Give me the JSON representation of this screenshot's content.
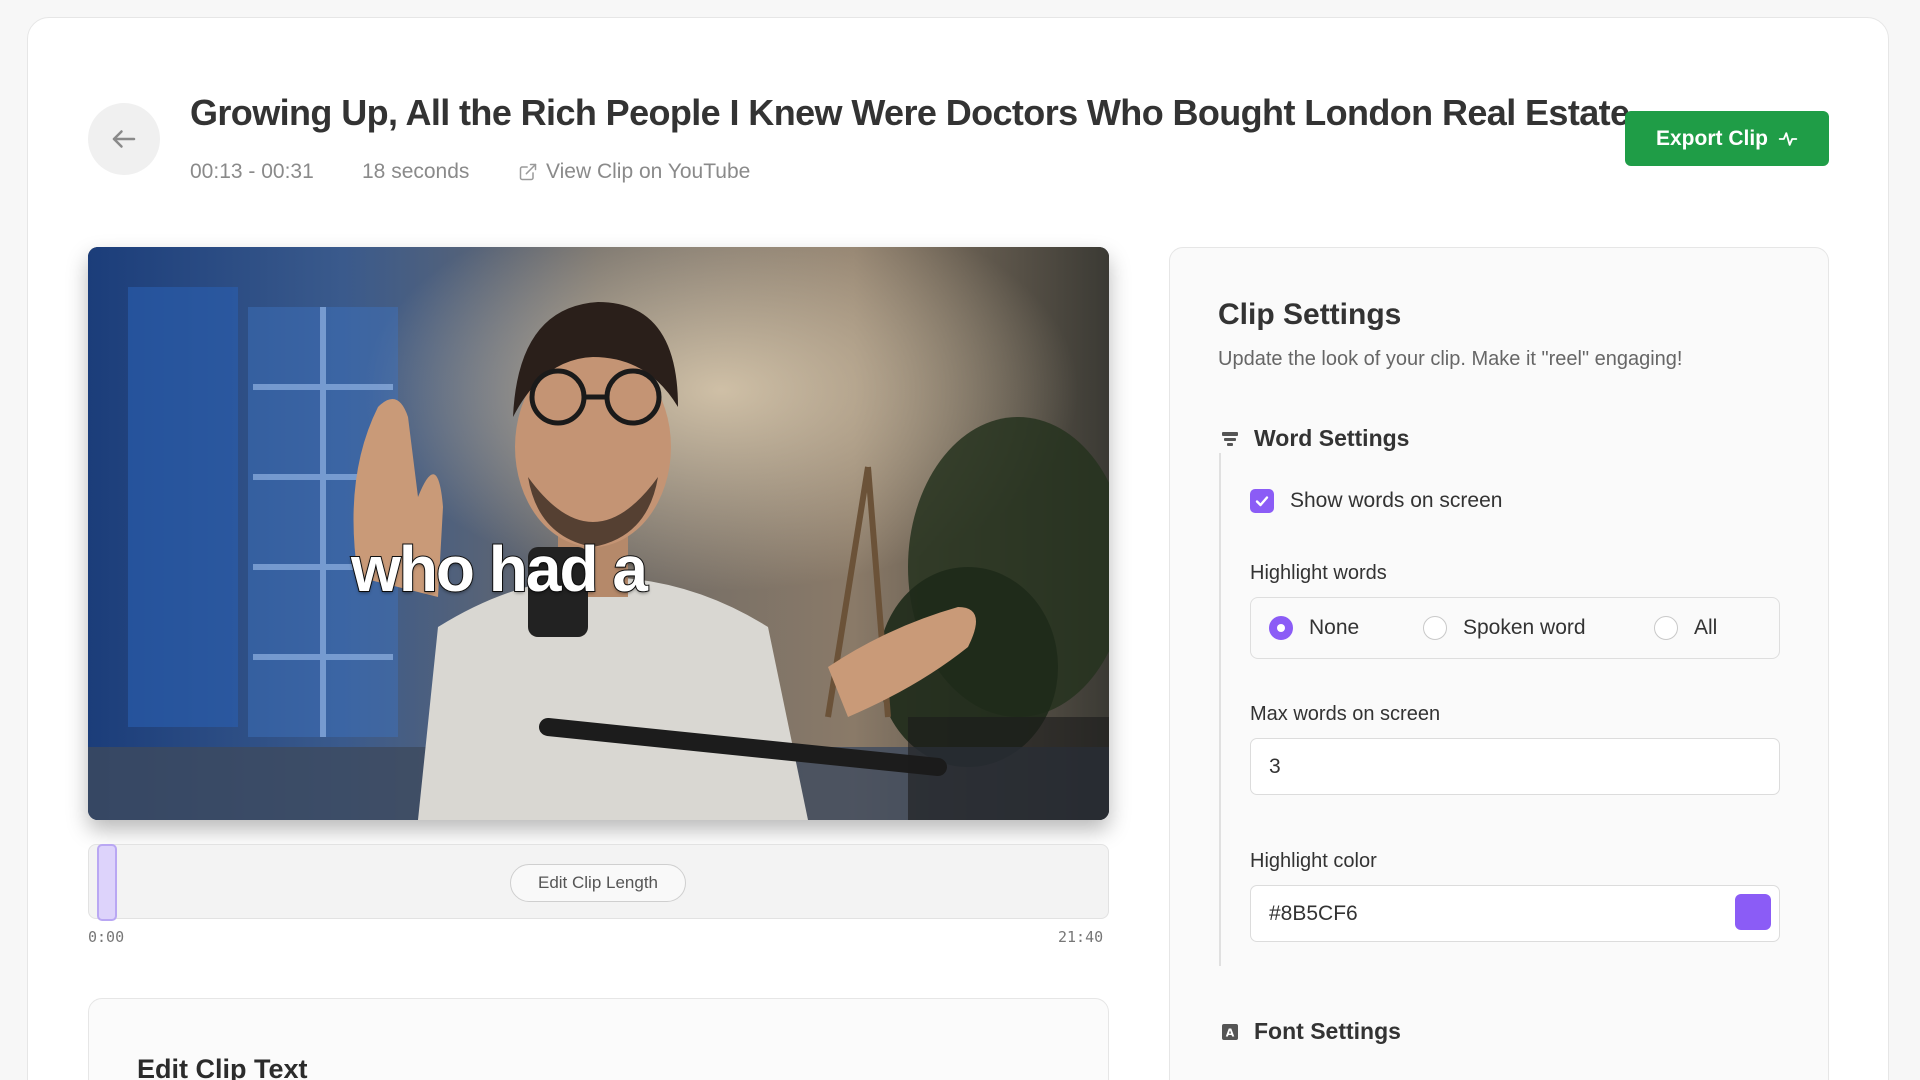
{
  "header": {
    "title": "Growing Up, All the Rich People I Knew Were Doctors Who Bought London Real Estate",
    "time_range": "00:13 - 00:31",
    "duration": "18 seconds",
    "youtube_link": "View Clip on YouTube",
    "export_label": "Export Clip",
    "back_icon": "arrow-left-icon",
    "export_icon": "activity-icon"
  },
  "video": {
    "caption": "who had a"
  },
  "timeline": {
    "edit_length_label": "Edit Clip Length",
    "start": "0:00",
    "end": "21:40"
  },
  "edit_text": {
    "title": "Edit Clip Text"
  },
  "settings": {
    "title": "Clip Settings",
    "subtitle": "Update the look of your clip. Make it \"reel\" engaging!",
    "word_settings": {
      "heading": "Word Settings",
      "show_words_label": "Show words on screen",
      "show_words_checked": true,
      "highlight_label": "Highlight words",
      "highlight_options": [
        "None",
        "Spoken word",
        "All"
      ],
      "highlight_selected": "None",
      "max_words_label": "Max words on screen",
      "max_words_value": "3",
      "highlight_color_label": "Highlight color",
      "highlight_color_value": "#8B5CF6"
    },
    "font_settings": {
      "heading": "Font Settings"
    }
  },
  "colors": {
    "accent": "#8B5CF6",
    "export_green": "#1F9D47"
  }
}
